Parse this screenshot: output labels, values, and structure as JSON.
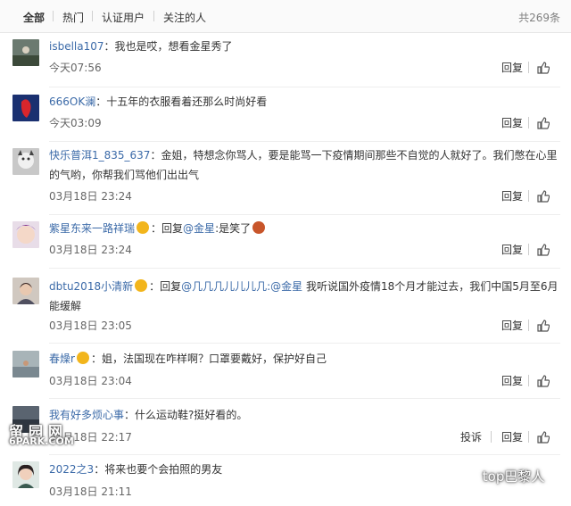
{
  "tabs": [
    "全部",
    "热门",
    "认证用户",
    "关注的人"
  ],
  "total": "共269条",
  "actions": {
    "reply": "回复",
    "report": "投诉"
  },
  "comments": [
    {
      "user": "isbella107",
      "sep": "：",
      "text": "我也是哎，想看金星秀了",
      "time": "今天07:56"
    },
    {
      "user": "666OK澜",
      "sep": "：",
      "text": "十五年的衣服看着还那么时尚好看",
      "time": "今天03:09"
    },
    {
      "user": "快乐普洱1_835_637",
      "sep": "：",
      "text": "金姐，特想念你骂人，要是能骂一下疫情期间那些不自觉的人就好了。我们憋在心里的气哟，你帮我们骂他们出出气",
      "time": "03月18日 23:24"
    },
    {
      "user": "紫星东来一路祥瑞",
      "sep": "：",
      "text_a": "回复",
      "mention": "@金星",
      "text_b": ":是笑了",
      "time": "03月18日 23:24"
    },
    {
      "user": "dbtu2018小清新",
      "sep": "：",
      "text_a": "回复",
      "mention": "@几几几儿儿儿几:@金星",
      "text_b": " 我听说国外疫情18个月才能过去，我们中国5月至6月能缓解",
      "time": "03月18日 23:05"
    },
    {
      "user": "春燥r",
      "sep": "：",
      "text": "姐，法国现在咋样啊？口罩要戴好，保护好自己",
      "time": "03月18日 23:04"
    },
    {
      "user": "我有好多烦心事",
      "sep": "：",
      "text": "什么运动鞋?挺好看的。",
      "time": "03月18日 22:17"
    },
    {
      "user": "2022之3",
      "sep": "：",
      "text": "将来也要个会拍照的男友",
      "time": "03月18日 21:11"
    }
  ],
  "watermark": {
    "line1": "留园网",
    "line2": "6PARK.COM"
  },
  "wechat_mark": "top巴黎人",
  "colors": {
    "link": "#3b6aa8",
    "time": "#666666",
    "divider": "#eeeeee"
  }
}
